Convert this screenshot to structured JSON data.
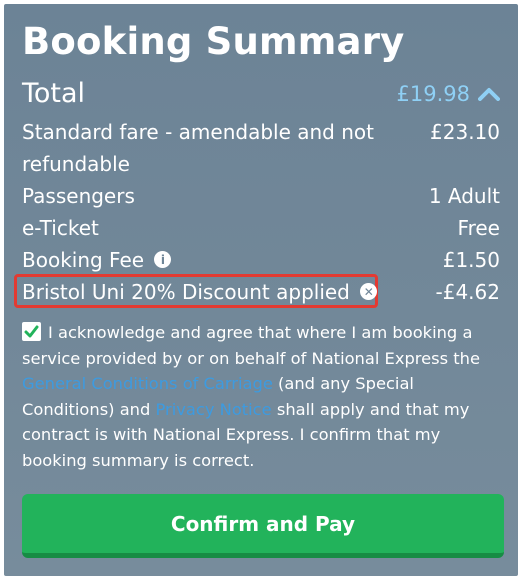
{
  "summary": {
    "title": "Booking Summary",
    "total_label": "Total",
    "total_value": "£19.98",
    "rows": [
      {
        "label": "Standard fare - amendable and not refundable",
        "value": "£23.10"
      },
      {
        "label": "Passengers",
        "value": "1 Adult"
      },
      {
        "label": "e-Ticket",
        "value": "Free"
      },
      {
        "label": "Booking Fee",
        "value": "£1.50"
      },
      {
        "label": "Bristol Uni 20% Discount applied",
        "value": "-£4.62"
      }
    ]
  },
  "ack": {
    "text1": "I acknowledge and agree that where I am booking a service provided by or on behalf of National Express the ",
    "link1": "General Conditions of Carriage",
    "text2": " (and any Special Conditions) and ",
    "link2": "Privacy Notice",
    "text3": " shall apply and that my contract is with National Express. I confirm that my booking summary is correct.",
    "checked": true
  },
  "cta": {
    "label": "Confirm and Pay"
  },
  "colors": {
    "link": "#3d9be0",
    "total": "#8fd0f5",
    "button": "#22b35b",
    "highlight": "#e33a32"
  },
  "icons": {
    "total_toggle": "chevron-up-icon",
    "fee_info": "info-icon",
    "discount_remove": "remove-circle-icon",
    "checkbox": "check-icon"
  }
}
